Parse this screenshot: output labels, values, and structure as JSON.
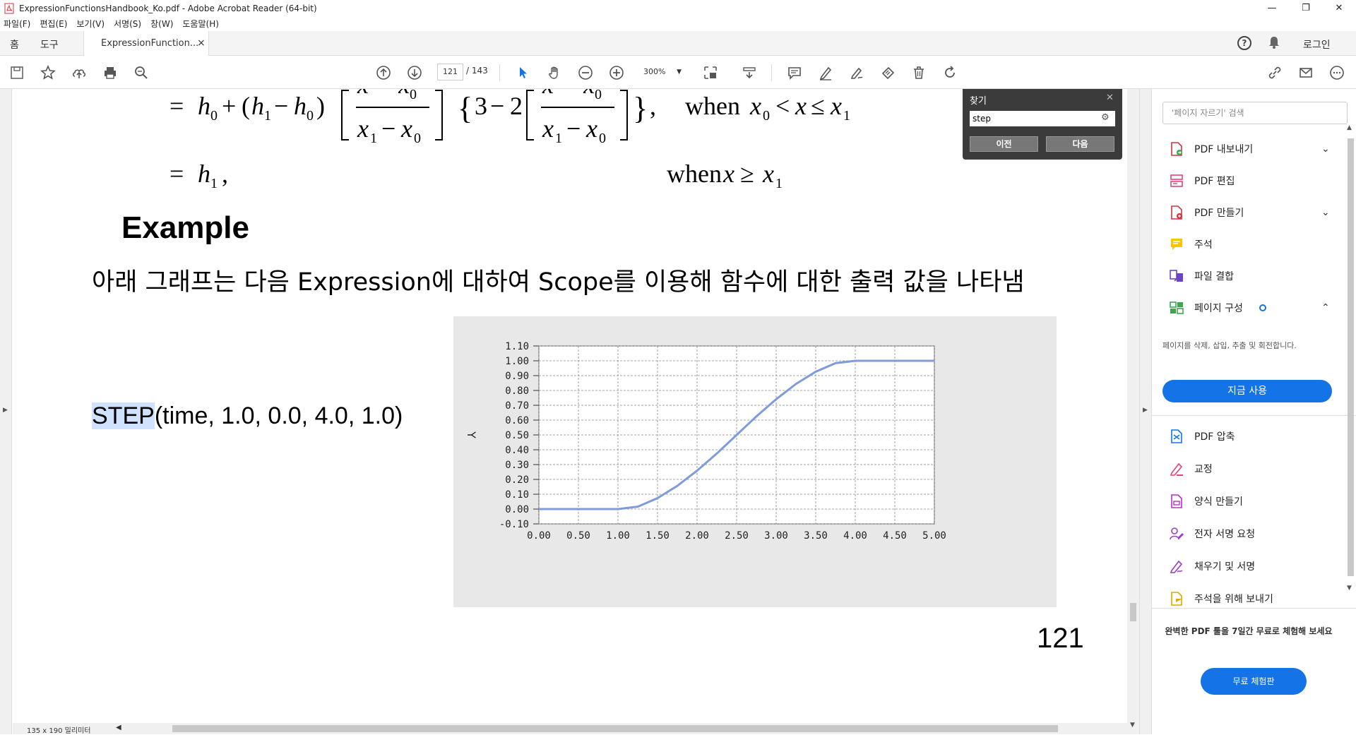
{
  "window": {
    "title": "ExpressionFunctionsHandbook_Ko.pdf - Adobe Acrobat Reader (64-bit)",
    "minimize": "—",
    "restore": "❐",
    "close": "✕"
  },
  "menu": [
    "파일(F)",
    "편집(E)",
    "보기(V)",
    "서명(S)",
    "창(W)",
    "도움말(H)"
  ],
  "tabs": {
    "home": "홈",
    "tools": "도구",
    "document": "ExpressionFunction...",
    "close": "×",
    "login": "로그인"
  },
  "toolbar": {
    "current_page": "121",
    "page_sep": "/ 143",
    "zoom": "300%"
  },
  "document": {
    "example_heading": "Example",
    "paragraph": "아래 그래프는 다음 Expression에 대하여 Scope를 이용해 함수에 대한 출력 값을 나타냄",
    "step_highlight": "STEP",
    "step_rest": "(time, 1.0, 0.0, 4.0, 1.0)",
    "page_number": "121",
    "status_dims": "135 x 190 밀리미터"
  },
  "find": {
    "title": "찾기",
    "query": "step",
    "prev": "이전",
    "next": "다음"
  },
  "right_pane": {
    "search_placeholder": "'페이지 자르기' 검색",
    "items": [
      {
        "label": "PDF 내보내기",
        "icon": "export-pdf-icon",
        "color": "#d5333f"
      },
      {
        "label": "PDF 편집",
        "icon": "edit-pdf-icon",
        "color": "#e0457b"
      },
      {
        "label": "PDF 만들기",
        "icon": "create-pdf-icon",
        "color": "#d5333f"
      },
      {
        "label": "주석",
        "icon": "comment-icon",
        "color": "#f6c700"
      },
      {
        "label": "파일 결합",
        "icon": "combine-files-icon",
        "color": "#6b45c9"
      },
      {
        "label": "페이지 구성",
        "icon": "organize-pages-icon",
        "color": "#3da74e"
      }
    ],
    "organize_desc": "페이지를 삭제, 삽입, 추출 및 회전합니다.",
    "use_now": "지금 사용",
    "items2": [
      {
        "label": "PDF 압축",
        "icon": "compress-pdf-icon",
        "color": "#1473e6"
      },
      {
        "label": "교정",
        "icon": "redact-icon",
        "color": "#e0457b"
      },
      {
        "label": "양식 만들기",
        "icon": "prepare-form-icon",
        "color": "#b930c6"
      },
      {
        "label": "전자 서명 요청",
        "icon": "request-signature-icon",
        "color": "#9a3cc9"
      },
      {
        "label": "채우기 및 서명",
        "icon": "fill-sign-icon",
        "color": "#9a3cc9"
      },
      {
        "label": "주석을 위해 보내기",
        "icon": "send-comments-icon",
        "color": "#f6c700"
      }
    ],
    "promo_text": "완벽한 PDF 툴을 7일간 무료로 체험해 보세요",
    "promo_button": "무료 체험판"
  },
  "chart_data": {
    "type": "line",
    "ylabel": "Y",
    "xlabel": "",
    "title": "",
    "xlim": [
      0.0,
      5.0
    ],
    "ylim": [
      -0.1,
      1.1
    ],
    "x_ticks": [
      "0.00",
      "0.50",
      "1.00",
      "1.50",
      "2.00",
      "2.50",
      "3.00",
      "3.50",
      "4.00",
      "4.50",
      "5.00"
    ],
    "y_ticks": [
      "1.10",
      "1.00",
      "0.90",
      "0.80",
      "0.70",
      "0.60",
      "0.50",
      "0.40",
      "0.30",
      "0.20",
      "0.10",
      "0.00",
      "-0.10"
    ],
    "grid": true,
    "series": [
      {
        "color": "#7e9bdc",
        "x": [
          0.0,
          0.5,
          1.0,
          1.25,
          1.5,
          1.75,
          2.0,
          2.25,
          2.5,
          2.75,
          3.0,
          3.25,
          3.5,
          3.75,
          4.0,
          4.5,
          5.0
        ],
        "y": [
          0.0,
          0.0,
          0.0,
          0.016,
          0.074,
          0.156,
          0.259,
          0.375,
          0.5,
          0.625,
          0.741,
          0.844,
          0.926,
          0.984,
          1.0,
          1.0,
          1.0
        ]
      }
    ]
  }
}
